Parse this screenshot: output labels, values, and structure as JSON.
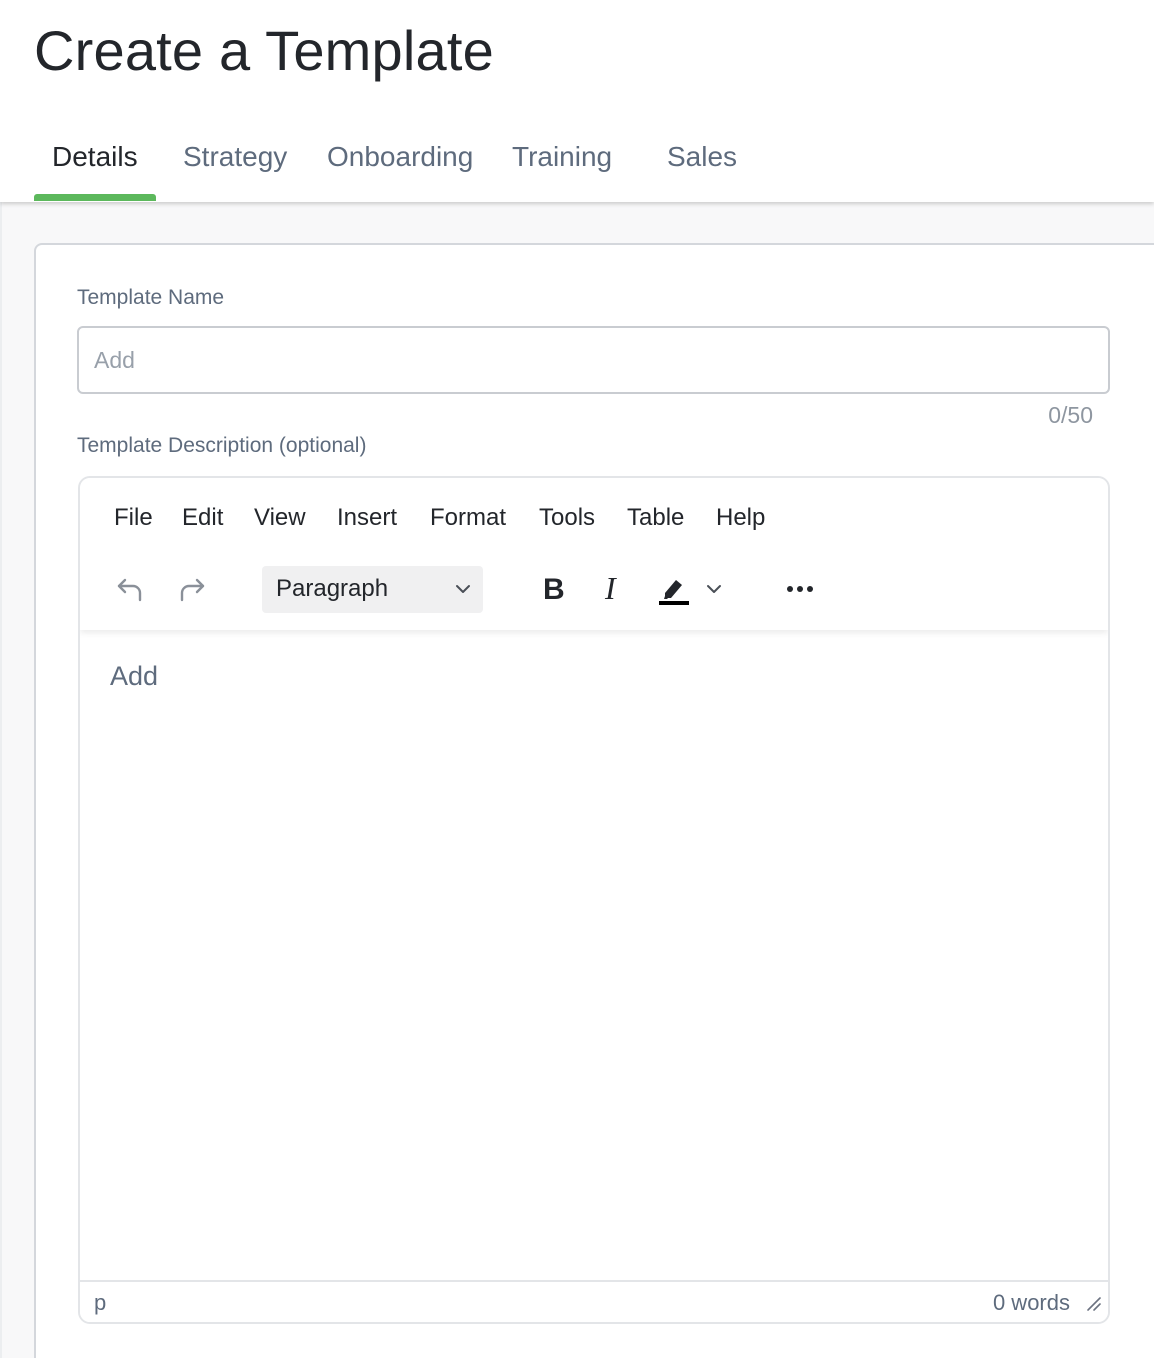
{
  "page": {
    "title": "Create a Template"
  },
  "tabs": [
    {
      "label": "Details",
      "active": true
    },
    {
      "label": "Strategy",
      "active": false
    },
    {
      "label": "Onboarding",
      "active": false
    },
    {
      "label": "Training",
      "active": false
    },
    {
      "label": "Sales",
      "active": false
    }
  ],
  "colors": {
    "accent": "#5cb85c",
    "text_primary": "#23262b",
    "text_secondary": "#5e6b7d"
  },
  "form": {
    "name_label": "Template Name",
    "name_value": "",
    "name_placeholder": "Add",
    "name_counter": "0/50",
    "description_label": "Template Description (optional)"
  },
  "editor": {
    "menu": [
      "File",
      "Edit",
      "View",
      "Insert",
      "Format",
      "Tools",
      "Table",
      "Help"
    ],
    "toolbar": {
      "undo_icon": "undo-icon",
      "redo_icon": "redo-icon",
      "block_format": "Paragraph",
      "bold_icon": "bold-icon",
      "italic_icon": "italic-icon",
      "highlight_icon": "highlight-icon",
      "more_icon": "more-icon"
    },
    "placeholder": "Add",
    "status_path": "p",
    "word_count": "0 words"
  }
}
